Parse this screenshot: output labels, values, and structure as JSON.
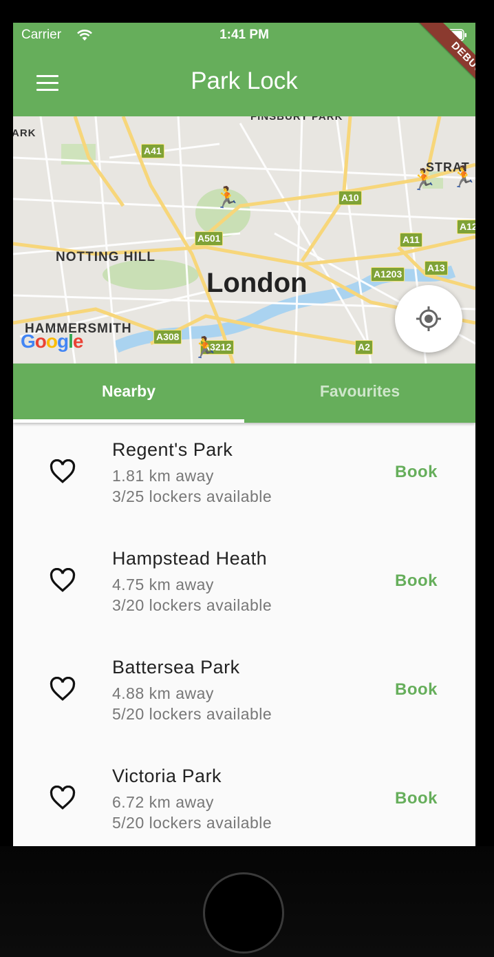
{
  "status_bar": {
    "carrier": "Carrier",
    "time": "1:41 PM"
  },
  "app_bar": {
    "title": "Park Lock",
    "debug_banner": "DEBUG"
  },
  "map": {
    "labels": {
      "london": "London",
      "notting_hill": "NOTTING HILL",
      "hammersmith": "HAMMERSMITH",
      "finsbury_park": "FINSBURY PARK",
      "strat": "STRAT",
      "ark": "ARK"
    },
    "roads": [
      "A41",
      "A10",
      "A501",
      "A11",
      "A1203",
      "A13",
      "A308",
      "A2",
      "A3212",
      "A12"
    ],
    "google": "Google"
  },
  "tabs": {
    "nearby": "Nearby",
    "favourites": "Favourites"
  },
  "parks": [
    {
      "name": "Regent's Park",
      "distance": "1.81 km away",
      "lockers": "3/25 lockers available",
      "book": "Book"
    },
    {
      "name": "Hampstead Heath",
      "distance": "4.75 km away",
      "lockers": "3/20 lockers available",
      "book": "Book"
    },
    {
      "name": "Battersea Park",
      "distance": "4.88 km away",
      "lockers": "5/20 lockers available",
      "book": "Book"
    },
    {
      "name": "Victoria Park",
      "distance": "6.72 km away",
      "lockers": "5/20 lockers available",
      "book": "Book"
    }
  ],
  "colors": {
    "primary": "#66ae5b",
    "debug": "#8b3a2f"
  }
}
